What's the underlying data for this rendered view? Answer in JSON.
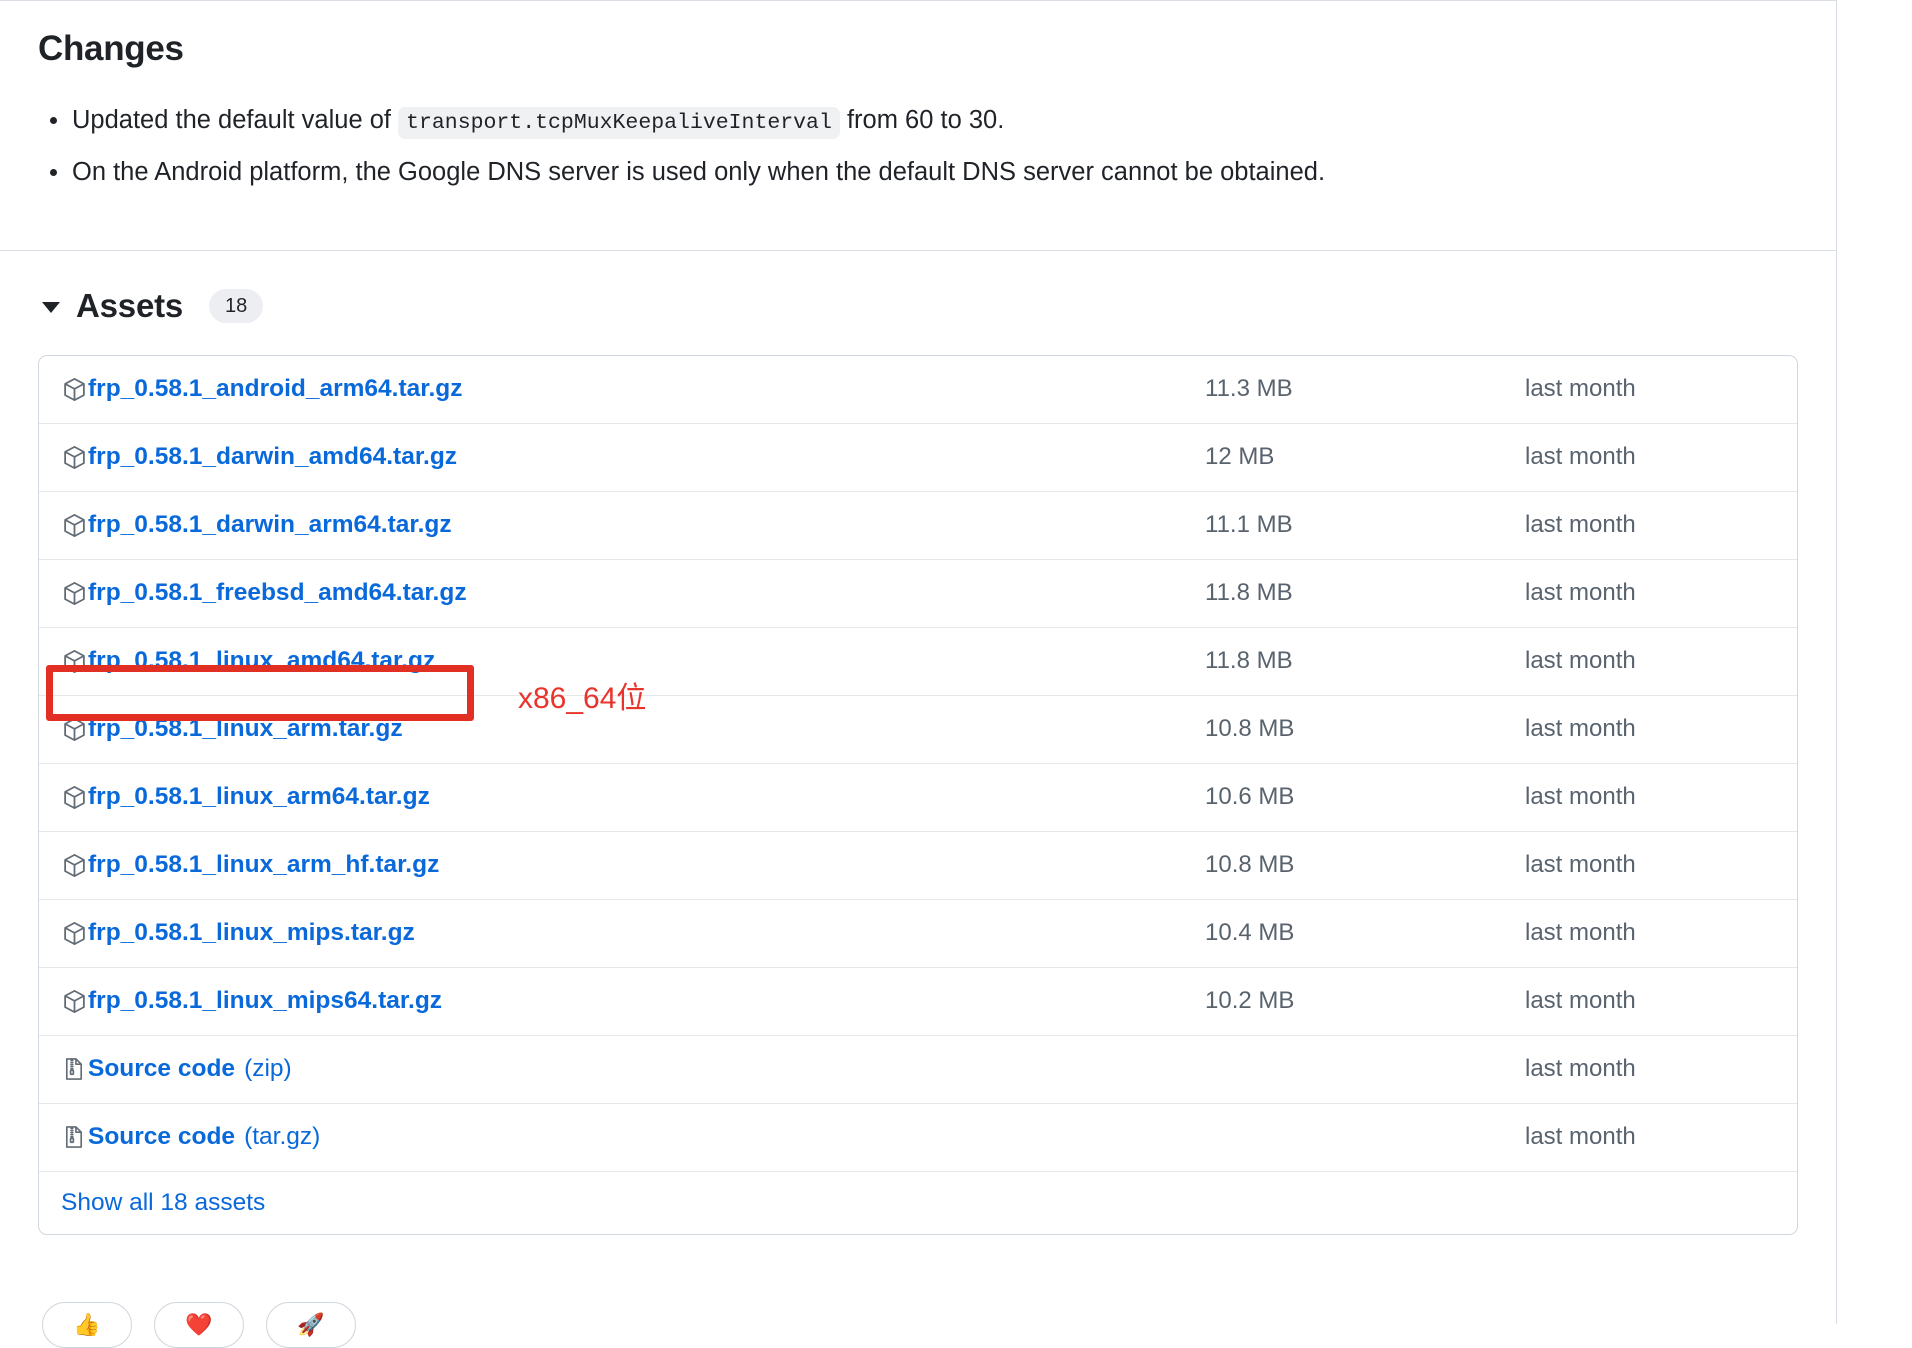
{
  "changes": {
    "heading": "Changes",
    "bullets": [
      {
        "prefix": "Updated the default value of",
        "code": "transport.tcpMuxKeepaliveInterval",
        "suffix": "from 60 to 30."
      },
      {
        "prefix": "On the Android platform, the Google DNS server is used only when the default DNS server cannot be obtained.",
        "code": "",
        "suffix": ""
      }
    ]
  },
  "assets": {
    "heading": "Assets",
    "count": "18",
    "show_all_label": "Show all 18 assets",
    "rows": [
      {
        "name": "frp_0.58.1_android_arm64.tar.gz",
        "suffix": "",
        "icon": "package-icon",
        "size": "11.3 MB",
        "date": "last month"
      },
      {
        "name": "frp_0.58.1_darwin_amd64.tar.gz",
        "suffix": "",
        "icon": "package-icon",
        "size": "12 MB",
        "date": "last month"
      },
      {
        "name": "frp_0.58.1_darwin_arm64.tar.gz",
        "suffix": "",
        "icon": "package-icon",
        "size": "11.1 MB",
        "date": "last month"
      },
      {
        "name": "frp_0.58.1_freebsd_amd64.tar.gz",
        "suffix": "",
        "icon": "package-icon",
        "size": "11.8 MB",
        "date": "last month"
      },
      {
        "name": "frp_0.58.1_linux_amd64.tar.gz",
        "suffix": "",
        "icon": "package-icon",
        "size": "11.8 MB",
        "date": "last month"
      },
      {
        "name": "frp_0.58.1_linux_arm.tar.gz",
        "suffix": "",
        "icon": "package-icon",
        "size": "10.8 MB",
        "date": "last month"
      },
      {
        "name": "frp_0.58.1_linux_arm64.tar.gz",
        "suffix": "",
        "icon": "package-icon",
        "size": "10.6 MB",
        "date": "last month"
      },
      {
        "name": "frp_0.58.1_linux_arm_hf.tar.gz",
        "suffix": "",
        "icon": "package-icon",
        "size": "10.8 MB",
        "date": "last month"
      },
      {
        "name": "frp_0.58.1_linux_mips.tar.gz",
        "suffix": "",
        "icon": "package-icon",
        "size": "10.4 MB",
        "date": "last month"
      },
      {
        "name": "frp_0.58.1_linux_mips64.tar.gz",
        "suffix": "",
        "icon": "package-icon",
        "size": "10.2 MB",
        "date": "last month"
      },
      {
        "name": "Source code",
        "suffix": "(zip)",
        "icon": "file-zip-icon",
        "size": "",
        "date": "last month"
      },
      {
        "name": "Source code",
        "suffix": "(tar.gz)",
        "icon": "file-zip-icon",
        "size": "",
        "date": "last month"
      }
    ]
  },
  "annotation": {
    "text": "x86_64位",
    "color": "#e8342b",
    "target_row": "frp_0.58.1_linux_amd64.tar.gz"
  },
  "reactions": [
    {
      "emoji": "👍",
      "name": "thumbs-up-reaction"
    },
    {
      "emoji": "❤️",
      "name": "heart-reaction"
    },
    {
      "emoji": "🚀",
      "name": "rocket-reaction"
    }
  ],
  "colors": {
    "link": "#0969da",
    "muted": "#59636e",
    "border": "#d0d7de",
    "annotation_red": "#e13023"
  }
}
